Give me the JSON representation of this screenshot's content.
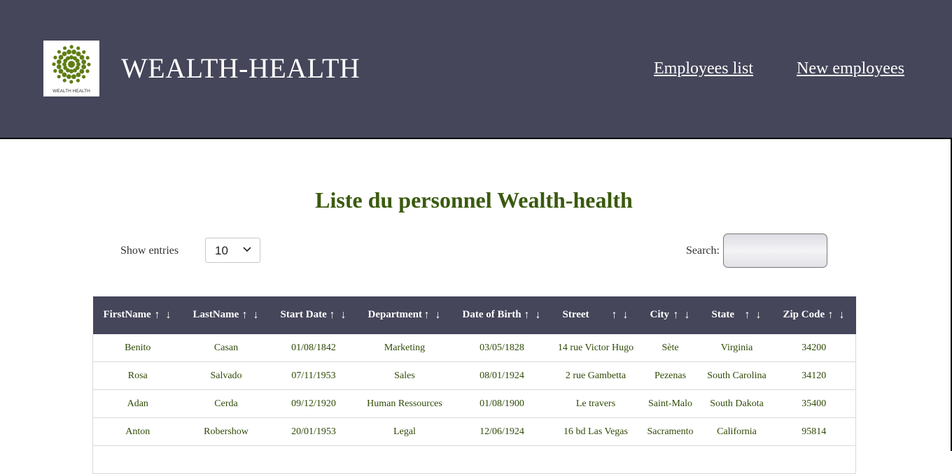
{
  "brand": {
    "name": "WEALTH-HEALTH",
    "logo_caption": "WEALTH HEALTH",
    "logo_color": "#5f7d15"
  },
  "nav": {
    "employees_list": "Employees list",
    "new_employees": "New employees"
  },
  "page": {
    "title": "Liste du personnel Wealth-health"
  },
  "controls": {
    "show_entries_label": "Show entries",
    "entries_value": "10",
    "search_label": "Search:",
    "search_value": ""
  },
  "table": {
    "columns": [
      "FirstName",
      "LastName",
      "Start Date",
      "Department",
      "Date of Birth",
      "Street",
      "City",
      "State",
      "Zip Code"
    ],
    "sort_up": "↑",
    "sort_down": "↓",
    "rows": [
      [
        "Benito",
        "Casan",
        "01/08/1842",
        "Marketing",
        "03/05/1828",
        "14 rue Victor Hugo",
        "Sète",
        "Virginia",
        "34200"
      ],
      [
        "Rosa",
        "Salvado",
        "07/11/1953",
        "Sales",
        "08/01/1924",
        "2 rue Gambetta",
        "Pezenas",
        "South Carolina",
        "34120"
      ],
      [
        "Adan",
        "Cerda",
        "09/12/1920",
        "Human Ressources",
        "01/08/1900",
        "Le travers",
        "Saint-Malo",
        "South Dakota",
        "35400"
      ],
      [
        "Anton",
        "Robershow",
        "20/01/1953",
        "Legal",
        "12/06/1924",
        "16 bd Las Vegas",
        "Sacramento",
        "California",
        "95814"
      ]
    ]
  },
  "colors": {
    "header_bg": "#45465a",
    "title_green": "#3a5a0e",
    "cell_text": "#2f4a06"
  }
}
